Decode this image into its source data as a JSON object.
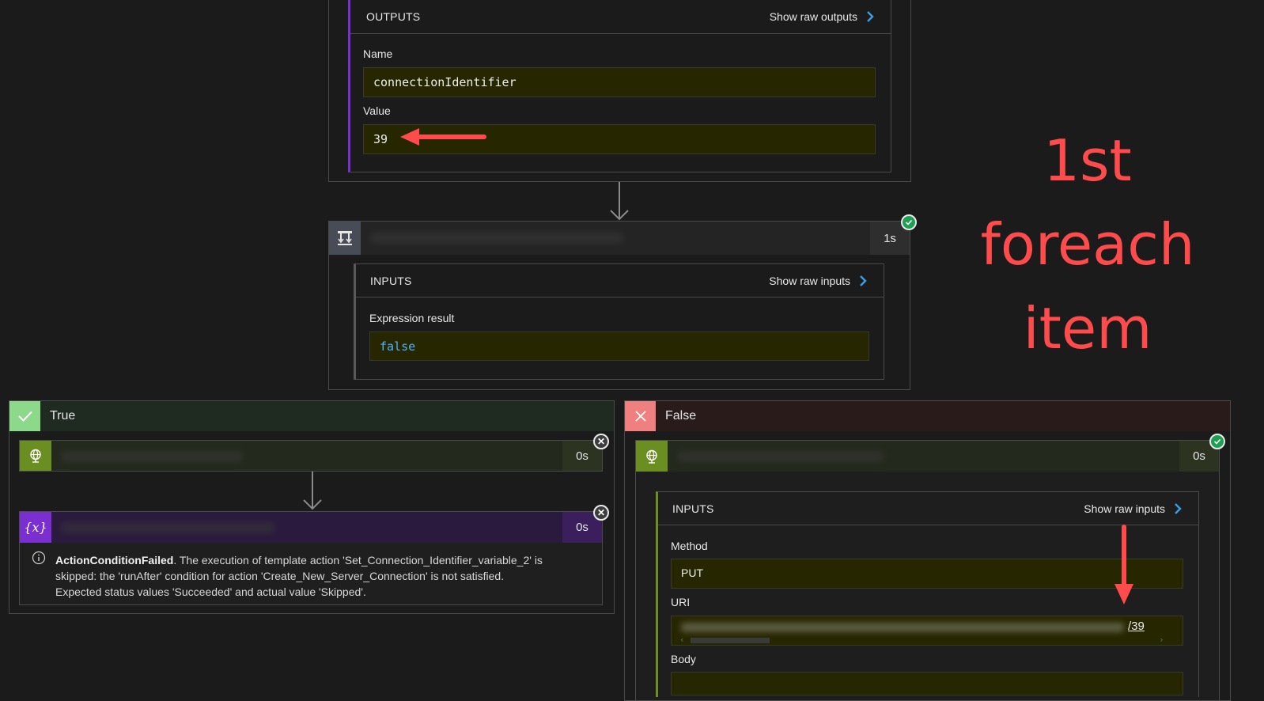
{
  "top_card": {
    "outputs_title": "OUTPUTS",
    "show_raw_outputs": "Show raw outputs",
    "name_label": "Name",
    "name_value": "connectionIdentifier",
    "value_label": "Value",
    "value_value": "39"
  },
  "condition": {
    "duration": "1s",
    "inputs_title": "INPUTS",
    "show_raw_inputs": "Show raw inputs",
    "expr_label": "Expression result",
    "expr_value": "false"
  },
  "true_branch": {
    "label": "True",
    "action1_duration": "0s",
    "action2_duration": "0s",
    "message_bold": "ActionConditionFailed",
    "message_line1": ". The execution of template action 'Set_Connection_Identifier_variable_2' is",
    "message_line2": "skipped: the 'runAfter' condition for action 'Create_New_Server_Connection' is not satisfied.",
    "message_line3": "Expected status values 'Succeeded' and actual value 'Skipped'."
  },
  "false_branch": {
    "label": "False",
    "action_duration": "0s",
    "inputs_title": "INPUTS",
    "show_raw_inputs": "Show raw inputs",
    "method_label": "Method",
    "method_value": "PUT",
    "uri_label": "URI",
    "uri_tail": "/39",
    "body_label": "Body"
  },
  "annotation": {
    "line1": "1st",
    "line2": "foreach",
    "line3": "item"
  },
  "colors": {
    "accent_blue": "#3b9fe8",
    "annotation_red": "#ff4b4b",
    "true_green": "#8cd98c",
    "false_red": "#f08080",
    "http_green": "#6b8e23",
    "variable_purple": "#7b2fd0"
  }
}
